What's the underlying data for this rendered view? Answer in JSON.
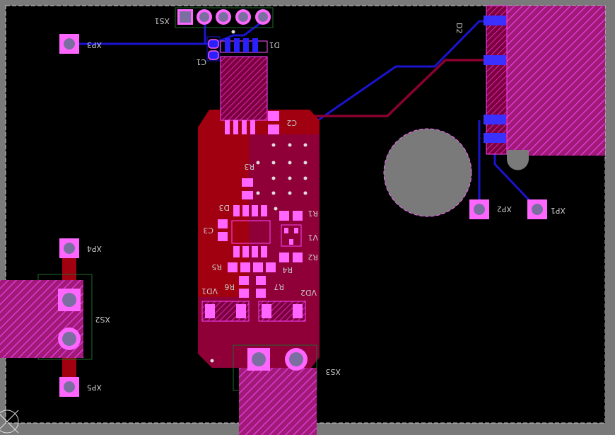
{
  "colors": {
    "background": "#7a7a7a",
    "board": "#000000",
    "top_copper": "#a00010",
    "bottom_copper": "#1a14d0",
    "overlay": "#ff22ff",
    "pad_fill": "#7a6fa0",
    "silkscreen": "#c8c8c8",
    "outline": "#d0d0d0"
  },
  "pcb": {
    "designators": {
      "xs1": "XS1",
      "xp3": "XP3",
      "d1": "D1",
      "c1": "C1",
      "d2": "D2",
      "c2": "C2",
      "r3": "R3",
      "d3": "D3",
      "r1": "R1",
      "c3": "C3",
      "v1": "V1",
      "r2": "R2",
      "r5": "R5",
      "r4": "R4",
      "r6": "R6",
      "r7": "R7",
      "vd1": "VD1",
      "vd2": "VD2",
      "xp2": "XP2",
      "xp1": "XP1",
      "xp4": "XP4",
      "xs2": "XS2",
      "xp5": "XP5",
      "xs3": "XS3"
    }
  }
}
